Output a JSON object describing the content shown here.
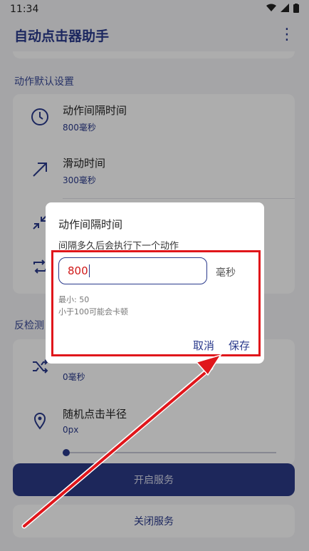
{
  "status": {
    "time": "11:34"
  },
  "appbar": {
    "title": "自动点击器助手",
    "more_icon": "more-vert-icon"
  },
  "sections": {
    "defaults_title": "动作默认设置",
    "anti_detect_title": "反检测"
  },
  "defaults": [
    {
      "label": "动作间隔时间",
      "value": "800毫秒",
      "icon": "clock-icon"
    },
    {
      "label": "滑动时间",
      "value": "300毫秒",
      "icon": "arrow-diagonal-icon"
    },
    {
      "label": "",
      "value": "",
      "icon": "shrink-icon"
    },
    {
      "label": "",
      "value": "",
      "icon": "repeat-icon"
    }
  ],
  "anti_detect": [
    {
      "label": "",
      "value": "0毫秒",
      "icon": "shuffle-icon"
    },
    {
      "label": "随机点击半径",
      "value": "0px",
      "icon": "location-icon"
    }
  ],
  "slider": {
    "value_fraction": 0
  },
  "buttons": {
    "start": "开启服务",
    "stop": "关闭服务"
  },
  "dialog": {
    "title": "动作间隔时间",
    "description": "间隔多久后会执行下一个动作",
    "input_value": "800",
    "unit": "毫秒",
    "hint_min": "最小: 50",
    "hint_warn": "小于100可能会卡顿",
    "cancel": "取消",
    "save": "保存"
  },
  "colors": {
    "accent": "#2a3a8c",
    "highlight": "#e0161b",
    "input_text": "#d01818"
  }
}
